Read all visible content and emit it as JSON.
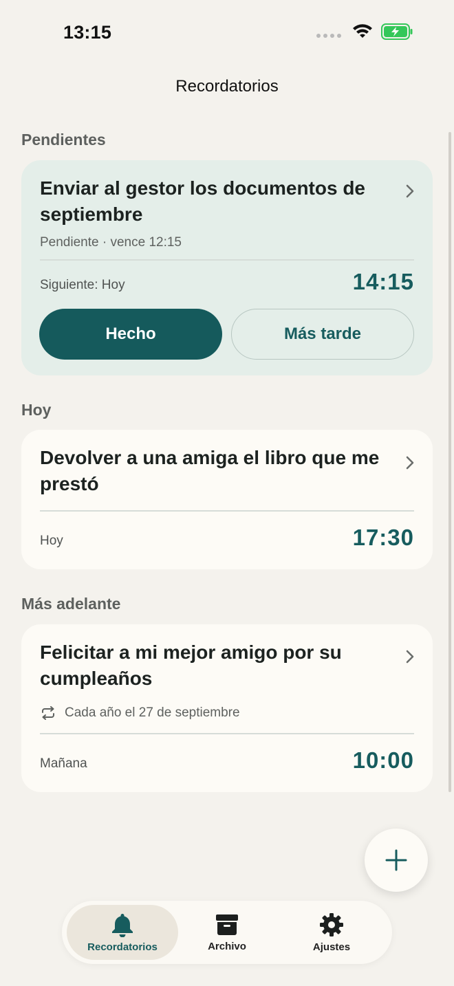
{
  "status_bar": {
    "time": "13:15"
  },
  "nav": {
    "title": "Recordatorios"
  },
  "sections": {
    "pending": "Pendientes",
    "today": "Hoy",
    "later": "Más adelante"
  },
  "cards": {
    "pending": {
      "title": "Enviar al gestor los documentos de septiembre",
      "subtitle": "Pendiente · vence 12:15",
      "footer_label": "Siguiente: Hoy",
      "time": "14:15",
      "done_label": "Hecho",
      "later_label": "Más tarde"
    },
    "today": {
      "title": "Devolver a una amiga el libro que me prestó",
      "footer_label": "Hoy",
      "time": "17:30"
    },
    "later": {
      "title": "Felicitar a mi mejor amigo por su cumpleaños",
      "repeat": "Cada año el 27 de septiembre",
      "footer_label": "Mañana",
      "time": "10:00"
    }
  },
  "tabbar": {
    "reminders": "Recordatorios",
    "archive": "Archivo",
    "settings": "Ajustes"
  },
  "colors": {
    "accent": "#155a5c",
    "background": "#f4f2ed",
    "highlight_card": "#e4eee9",
    "card": "#fdfbf6",
    "battery": "#34c759"
  },
  "icons": [
    "wifi-icon",
    "battery-icon",
    "chevron-right-icon",
    "repeat-icon",
    "plus-icon",
    "bell-icon",
    "archive-box-icon",
    "gear-icon"
  ]
}
